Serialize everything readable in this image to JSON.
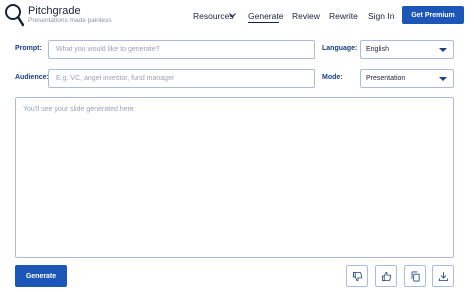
{
  "brand": {
    "name": "Pitchgrade",
    "tagline": "Presentations made painless"
  },
  "nav": {
    "resources": "Resources",
    "generate": "Generate",
    "review": "Review",
    "rewrite": "Rewrite",
    "signin": "Sign In",
    "premium": "Get Premium",
    "active": "Generate"
  },
  "form": {
    "prompt_label": "Prompt:",
    "prompt_placeholder": "What you would like to generate?",
    "language_label": "Language:",
    "language_value": "English",
    "audience_label": "Audience:",
    "audience_placeholder": "E.g. VC, angel investor, fund manager",
    "mode_label": "Mode:",
    "mode_value": "Presentation"
  },
  "output": {
    "placeholder": "You'll see your slide generated here"
  },
  "actions": {
    "generate": "Generate",
    "icons": [
      "thumbs-down-icon",
      "thumbs-up-icon",
      "copy-icon",
      "download-icon"
    ]
  },
  "colors": {
    "primary": "#1c56b8",
    "label": "#1c3f86",
    "border": "#a8bde0",
    "placeholder": "#9aa3b2"
  }
}
